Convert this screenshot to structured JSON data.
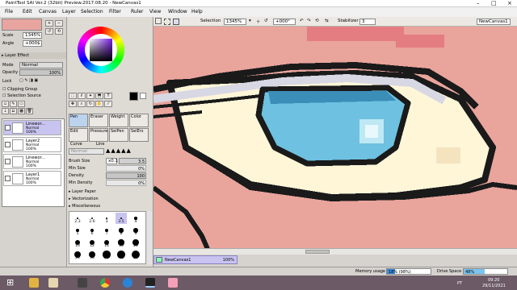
{
  "window": {
    "title": "PaintTool SAI Ver.2 (32bit) Preview.2017.08.20 - NewCanvas1",
    "controls": [
      "–",
      "□",
      "×"
    ]
  },
  "menu": [
    "File",
    "Edit",
    "Canvas",
    "Layer",
    "Selection",
    "Filter",
    "Ruler",
    "View",
    "Window",
    "Help"
  ],
  "toolbar": {
    "selection_label": "Selection",
    "zoom": "1345%",
    "rotation": "+000°",
    "stabilizer_label": "Stabilizer",
    "stabilizer_value": "3",
    "canvas_tab": "NewCanvas1"
  },
  "navigator": {
    "scale_label": "Scale",
    "scale_value": "1345%",
    "angle_label": "Angle",
    "angle_value": "+000$"
  },
  "layer_panel": {
    "effect_header": "Layer Effect",
    "mode_label": "Mode",
    "mode_value": "Normal",
    "opacity_label": "Opacity",
    "opacity_value": "100%",
    "lock_label": "Lock",
    "clipping_label": "Clipping Group",
    "selection_source_label": "Selection Source",
    "layers": [
      {
        "name": "Linewor...",
        "mode": "Normal",
        "opacity": "100%",
        "selected": true
      },
      {
        "name": "Layer2",
        "mode": "Normal",
        "opacity": "100%",
        "selected": false
      },
      {
        "name": "Linewor...",
        "mode": "Normal",
        "opacity": "100%",
        "selected": false
      },
      {
        "name": "Layer1",
        "mode": "Normal",
        "opacity": "100%",
        "selected": false
      }
    ]
  },
  "tools": {
    "tool_tabs": [
      "Pen",
      "Eraser",
      "Weight",
      "Color"
    ],
    "tool_tabs2": [
      "Edit",
      "Pressure",
      "SelPen",
      "SelErs"
    ],
    "curve_label": "Curve",
    "line_label": "Line",
    "blend_mode": "Normal",
    "brush_size_label": "Brush Size",
    "brush_size_mult": "x0.1",
    "brush_size_value": "3.5",
    "min_size_label": "Min Size",
    "min_size_value": "0%",
    "density_label": "Density",
    "density_value": "100",
    "min_density_label": "Min Density",
    "min_density_value": "0%",
    "layer_paper_label": "Layer Paper",
    "vectorization_label": "Vectorization",
    "misc_label": "Miscellaneous",
    "brush_sizes": [
      "2.3",
      "2.6",
      "3",
      "3.5",
      "4",
      "5",
      "6",
      "7",
      "8",
      "9",
      "10",
      "12",
      "14",
      "16",
      "20",
      "25",
      "30",
      "35",
      "40",
      "50"
    ]
  },
  "status": {
    "canvas_name": "NewCanvas1",
    "canvas_zoom": "100%",
    "memory_label": "Memory usage",
    "memory_value": "18% (98%)",
    "memory_fraction": 0.18,
    "drive_label": "Drive Space",
    "drive_value": "48%",
    "drive_fraction": 0.48
  },
  "taskbar": {
    "lang": "PT",
    "time": "09:20",
    "date": "29/11/2021"
  },
  "colors": {
    "accent": "#6bb3d6",
    "selected_layer": "#c8c4f0",
    "memory_bar": "#3e8ee0",
    "drive_bar": "#7bc4ef"
  }
}
